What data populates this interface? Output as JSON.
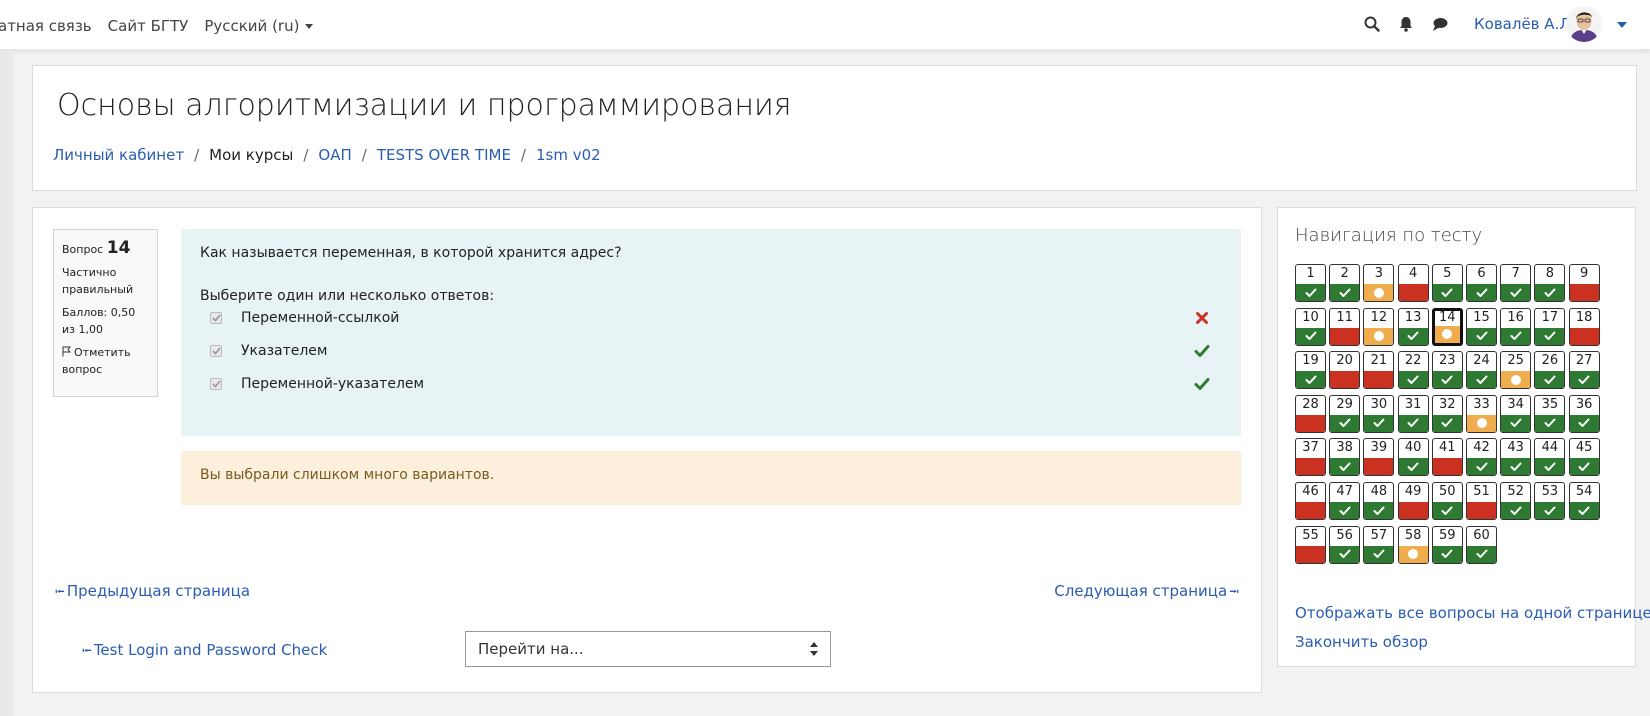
{
  "topbar": {
    "links": [
      "атная связь",
      "Сайт БГТУ"
    ],
    "language": "Русский (ru)",
    "username": "Ковалёв А.Л."
  },
  "course": {
    "title": "Основы алгоритмизации и программирования",
    "breadcrumb": [
      "Личный кабинет",
      "Мои курсы",
      "ОАП",
      "TESTS OVER TIME",
      "1sm v02"
    ]
  },
  "question": {
    "label": "Вопрос",
    "number": "14",
    "state": "Частично правильный",
    "grade": "Баллов: 0,50 из 1,00",
    "flag_label": "Отметить вопрос",
    "text": "Как называется переменная, в которой хранится адрес?",
    "prompt": "Выберите один или несколько ответов:",
    "answers": [
      {
        "label": "Переменной-ссылкой",
        "mark": "incorrect"
      },
      {
        "label": "Указателем",
        "mark": "correct"
      },
      {
        "label": "Переменной-указателем",
        "mark": "correct"
      }
    ],
    "feedback": "Вы выбрали слишком много вариантов."
  },
  "pager": {
    "prev": "Предыдущая страница",
    "next": "Следующая страница",
    "activity_prev": "Test Login and Password Check",
    "jump_select": "Перейти на..."
  },
  "quiz_nav": {
    "title": "Навигация по тесту",
    "current": 14,
    "questions": [
      {
        "n": "1",
        "s": "correct"
      },
      {
        "n": "2",
        "s": "correct"
      },
      {
        "n": "3",
        "s": "partial"
      },
      {
        "n": "4",
        "s": "incorrect"
      },
      {
        "n": "5",
        "s": "correct"
      },
      {
        "n": "6",
        "s": "correct"
      },
      {
        "n": "7",
        "s": "correct"
      },
      {
        "n": "8",
        "s": "correct"
      },
      {
        "n": "9",
        "s": "incorrect"
      },
      {
        "n": "10",
        "s": "correct"
      },
      {
        "n": "11",
        "s": "incorrect"
      },
      {
        "n": "12",
        "s": "partial"
      },
      {
        "n": "13",
        "s": "correct"
      },
      {
        "n": "14",
        "s": "partial"
      },
      {
        "n": "15",
        "s": "correct"
      },
      {
        "n": "16",
        "s": "correct"
      },
      {
        "n": "17",
        "s": "correct"
      },
      {
        "n": "18",
        "s": "incorrect"
      },
      {
        "n": "19",
        "s": "correct"
      },
      {
        "n": "20",
        "s": "incorrect"
      },
      {
        "n": "21",
        "s": "incorrect"
      },
      {
        "n": "22",
        "s": "correct"
      },
      {
        "n": "23",
        "s": "correct"
      },
      {
        "n": "24",
        "s": "correct"
      },
      {
        "n": "25",
        "s": "partial"
      },
      {
        "n": "26",
        "s": "correct"
      },
      {
        "n": "27",
        "s": "correct"
      },
      {
        "n": "28",
        "s": "incorrect"
      },
      {
        "n": "29",
        "s": "correct"
      },
      {
        "n": "30",
        "s": "correct"
      },
      {
        "n": "31",
        "s": "correct"
      },
      {
        "n": "32",
        "s": "correct"
      },
      {
        "n": "33",
        "s": "partial"
      },
      {
        "n": "34",
        "s": "correct"
      },
      {
        "n": "35",
        "s": "correct"
      },
      {
        "n": "36",
        "s": "correct"
      },
      {
        "n": "37",
        "s": "incorrect"
      },
      {
        "n": "38",
        "s": "correct"
      },
      {
        "n": "39",
        "s": "incorrect"
      },
      {
        "n": "40",
        "s": "correct"
      },
      {
        "n": "41",
        "s": "incorrect"
      },
      {
        "n": "42",
        "s": "correct"
      },
      {
        "n": "43",
        "s": "correct"
      },
      {
        "n": "44",
        "s": "correct"
      },
      {
        "n": "45",
        "s": "correct"
      },
      {
        "n": "46",
        "s": "incorrect"
      },
      {
        "n": "47",
        "s": "correct"
      },
      {
        "n": "48",
        "s": "correct"
      },
      {
        "n": "49",
        "s": "incorrect"
      },
      {
        "n": "50",
        "s": "correct"
      },
      {
        "n": "51",
        "s": "incorrect"
      },
      {
        "n": "52",
        "s": "correct"
      },
      {
        "n": "53",
        "s": "correct"
      },
      {
        "n": "54",
        "s": "correct"
      },
      {
        "n": "55",
        "s": "incorrect"
      },
      {
        "n": "56",
        "s": "correct"
      },
      {
        "n": "57",
        "s": "correct"
      },
      {
        "n": "58",
        "s": "partial"
      },
      {
        "n": "59",
        "s": "correct"
      },
      {
        "n": "60",
        "s": "correct"
      }
    ],
    "show_all": "Отображать все вопросы на одной странице",
    "finish": "Закончить обзор"
  },
  "colors": {
    "correct": "#2f7a32",
    "incorrect": "#ca3120",
    "partial": "#f0ad4e",
    "link": "#2a5db0"
  },
  "icons": {
    "search": "search-icon",
    "notifications": "bell-icon",
    "messages": "chat-icon",
    "flag": "flag-icon",
    "correct": "check-icon",
    "incorrect": "cross-icon",
    "partial": "dot-icon"
  }
}
